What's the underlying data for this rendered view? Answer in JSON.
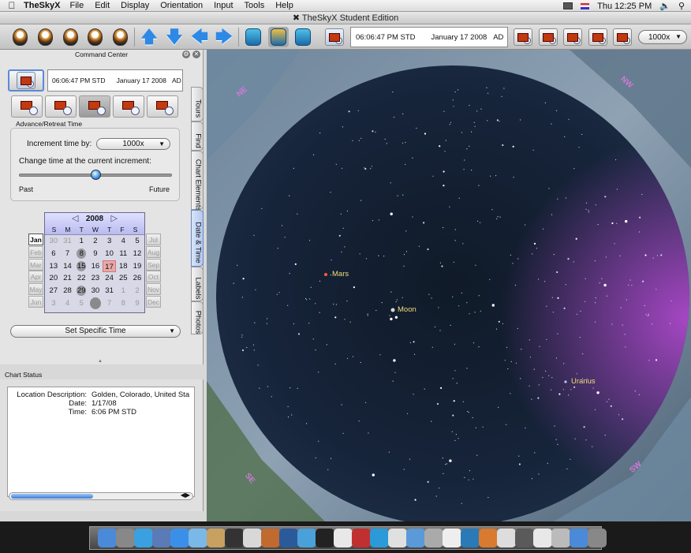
{
  "menubar": {
    "app_name": "TheSkyX",
    "items": [
      "File",
      "Edit",
      "Display",
      "Orientation",
      "Input",
      "Tools",
      "Help"
    ],
    "clock": "Thu 12:25 PM"
  },
  "window": {
    "title": "TheSkyX Student Edition"
  },
  "toolbar": {
    "time": "06:06:47 PM STD",
    "date": "January 17 2008",
    "era": "AD",
    "zoom": "1000x"
  },
  "command_center": {
    "title": "Command Center",
    "time": "06:06:47 PM  STD",
    "date": "January 17 2008",
    "era": "AD",
    "advance_label": "Advance/Retreat Time",
    "increment_label": "Increment time by:",
    "increment_value": "1000x",
    "change_label": "Change time at the current increment:",
    "past": "Past",
    "future": "Future",
    "slider_position": 0.5,
    "set_specific_time": "Set Specific Time"
  },
  "calendar": {
    "year": "2008",
    "dow": [
      "S",
      "M",
      "T",
      "W",
      "T",
      "F",
      "S"
    ],
    "months_left": [
      "Jan",
      "Feb",
      "Mar",
      "Apr",
      "May",
      "Jun"
    ],
    "months_right": [
      "Jul",
      "Aug",
      "Sep",
      "Oct",
      "Nov",
      "Dec"
    ],
    "weeks": [
      [
        "30",
        "31",
        "1",
        "2",
        "3",
        "4",
        "5"
      ],
      [
        "6",
        "7",
        "8",
        "9",
        "10",
        "11",
        "12"
      ],
      [
        "13",
        "14",
        "15",
        "16",
        "17",
        "18",
        "19"
      ],
      [
        "20",
        "21",
        "22",
        "23",
        "24",
        "25",
        "26"
      ],
      [
        "27",
        "28",
        "29",
        "30",
        "31",
        "1",
        "2"
      ],
      [
        "3",
        "4",
        "5",
        "",
        "7",
        "8",
        "9"
      ]
    ],
    "selected_day": "17"
  },
  "tabs": [
    "Tours",
    "Find",
    "Chart Elements",
    "Date & Time",
    "Labels",
    "Photos"
  ],
  "chart_status": {
    "title": "Chart Status",
    "rows": [
      {
        "k": "Location Description:",
        "v": "Golden, Colorado, United Sta"
      },
      {
        "k": "Date:",
        "v": "1/17/08"
      },
      {
        "k": "Time:",
        "v": "6:06 PM STD"
      }
    ]
  },
  "sky": {
    "labels": {
      "mars": "Mars",
      "moon": "Moon",
      "uranus": "Uranus"
    },
    "directions": {
      "ne": "NE",
      "nw": "NW",
      "se": "SE",
      "sw": "SW"
    }
  },
  "colors": {
    "accent": "#2d89e6",
    "label": "#f2dd7a",
    "direction": "#d07ad8",
    "sky": "#142030"
  }
}
